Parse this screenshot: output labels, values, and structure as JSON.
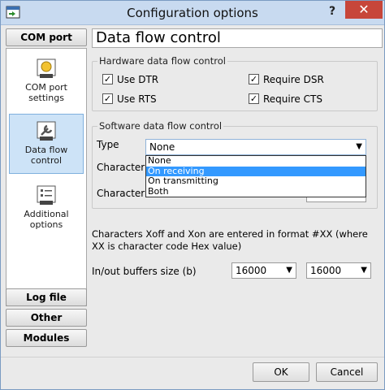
{
  "window": {
    "title": "Configuration options",
    "help": "?",
    "close": "✕"
  },
  "sidebar": {
    "com_port": "COM port",
    "items": [
      {
        "label": "COM port settings",
        "icon": "com-port-icon"
      },
      {
        "label": "Data flow control",
        "icon": "wrench-icon",
        "selected": true
      },
      {
        "label": "Additional options",
        "icon": "list-icon"
      }
    ],
    "log_file": "Log file",
    "other": "Other",
    "modules": "Modules"
  },
  "main": {
    "title": "Data flow control",
    "hardware": {
      "legend": "Hardware data flow control",
      "use_dtr": "Use DTR",
      "require_dsr": "Require DSR",
      "use_rts": "Use RTS",
      "require_cts": "Require CTS"
    },
    "software": {
      "legend": "Software data flow control",
      "type_label": "Type",
      "type_value": "None",
      "char1_label": "Character th",
      "char2_label": "Character th",
      "options": [
        "None",
        "On receiving",
        "On transmitting",
        "Both"
      ],
      "highlighted": "On receiving"
    },
    "note": "Characters Xoff and Xon are entered in format #XX (where XX is character code Hex value)",
    "buffers": {
      "label": "In/out buffers size (b)",
      "in_value": "16000",
      "out_value": "16000"
    }
  },
  "footer": {
    "ok": "OK",
    "cancel": "Cancel"
  }
}
